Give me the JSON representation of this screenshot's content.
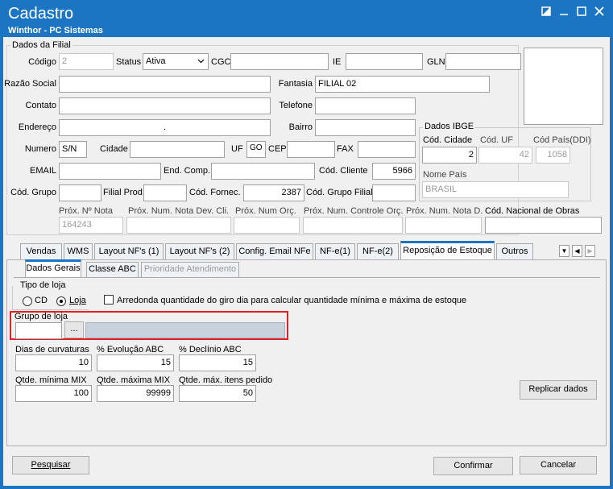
{
  "window": {
    "title": "Cadastro",
    "subtitle": "Winthor - PC Sistemas",
    "icons": {
      "restore": "restore-icon",
      "minimize": "minimize-icon",
      "maximize": "maximize-icon",
      "close": "close-icon"
    }
  },
  "filial": {
    "group_title": "Dados da Filial",
    "codigo_label": "Código",
    "codigo_value": "2",
    "status_label": "Status",
    "status_value": "Ativa",
    "cgc_label": "CGC",
    "cgc_value": "",
    "ie_label": "IE",
    "ie_value": "",
    "gln_label": "GLN",
    "gln_value": "",
    "razao_label": "Razão Social",
    "razao_value": "",
    "fantasia_label": "Fantasia",
    "fantasia_value": "FILIAL 02",
    "contato_label": "Contato",
    "contato_value": "",
    "telefone_label": "Telefone",
    "telefone_value": "",
    "endereco_label": "Endereço",
    "endereco_value": ".",
    "bairro_label": "Bairro",
    "bairro_value": "",
    "numero_label": "Numero",
    "numero_value": "S/N",
    "cidade_label": "Cidade",
    "cidade_value": "",
    "uf_label": "UF",
    "uf_value": "GO",
    "cep_label": "CEP",
    "cep_value": "",
    "fax_label": "FAX",
    "fax_value": "",
    "email_label": "EMAIL",
    "email_value": "",
    "endcomp_label": "End. Comp.",
    "endcomp_value": "",
    "codcliente_label": "Cód. Cliente",
    "codcliente_value": "5966",
    "codgrupo_label": "Cód. Grupo",
    "codgrupo_value": "",
    "filialprod_label": "Filial Prod.",
    "filialprod_value": "",
    "codfornec_label": "Cód. Fornec.",
    "codfornec_value": "2387",
    "codgrupofilial_label": "Cód. Grupo Filial",
    "codgrupofilial_value": ""
  },
  "ibge": {
    "group_title": "Dados IBGE",
    "codcidade_label": "Cód. Cidade",
    "codcidade_value": "2",
    "coduf_label": "Cód. UF",
    "coduf_value": "42",
    "codpais_label": "Cód País(DDI)",
    "codpais_value": "1058",
    "nomepais_label": "Nome País",
    "nomepais_value": "BRASIL"
  },
  "prox": {
    "nota_label": "Próx. Nº Nota",
    "nota_value": "164243",
    "notadev_label": "Próx. Num. Nota Dev. Cli.",
    "notadev_value": "",
    "orc_label": "Próx. Num Orç.",
    "orc_value": "",
    "controleorc_label": "Próx. Num. Controle Orç.",
    "controleorc_value": "",
    "notad_label": "Próx. Num. Nota D.",
    "notad_value": "",
    "obras_label": "Cód. Nacional de Obras",
    "obras_value": ""
  },
  "tabs": [
    "Vendas",
    "WMS",
    "Layout NF's (1)",
    "Layout NF's (2)",
    "Config. Email NFe",
    "NF-e(1)",
    "NF-e(2)",
    "Reposição de Estoque",
    "Outros"
  ],
  "subtabs": [
    "Dados Gerais",
    "Classe ABC",
    "Prioridade Atendimento"
  ],
  "reposicao": {
    "tipo_loja_title": "Tipo de loja",
    "cd_label": "CD",
    "loja_label": "Loja",
    "arredonda_label": "Arredonda quantidade do giro dia  para calcular quantidade mínima e máxima de estoque",
    "grupo_loja_title": "Grupo de loja",
    "grupo_value": "",
    "browse_label": "...",
    "dias_label": "Dias de curvaturas",
    "dias_value": "10",
    "evol_label": "% Evolução ABC",
    "evol_value": "15",
    "decl_label": "% Declínio ABC",
    "decl_value": "15",
    "min_label": "Qtde. mínima MIX",
    "min_value": "100",
    "max_label": "Qtde. máxima MIX",
    "max_value": "99999",
    "maxitens_label": "Qtde. máx. itens pedido",
    "maxitens_value": "50",
    "replicar_label": "Replicar dados"
  },
  "footer": {
    "pesquisar_label": "Pesquisar",
    "confirmar_label": "Confirmar",
    "cancelar_label": "Cancelar"
  },
  "colors": {
    "titlebar": "#1b75c3",
    "highlight": "#e31e24",
    "client": "#f0f0f0"
  }
}
